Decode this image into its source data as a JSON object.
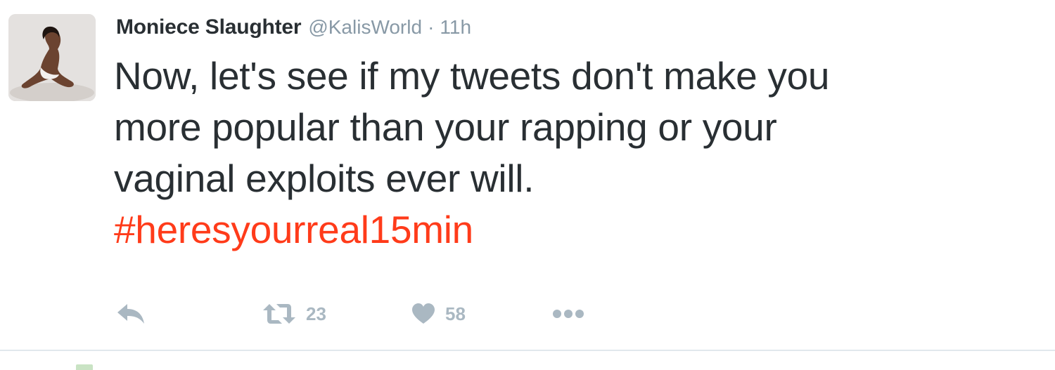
{
  "tweet": {
    "author": {
      "display_name": "Moniece Slaughter",
      "handle": "@KalisWorld",
      "separator": "·",
      "time": "11h",
      "avatar": "profile-photo"
    },
    "text_lines": [
      "Now, let's see if my tweets don't make you",
      "more popular than your rapping or your",
      "vaginal exploits ever will."
    ],
    "hashtag": "#heresyourreal15min",
    "actions": {
      "reply_icon": "reply-icon",
      "retweet_icon": "retweet-icon",
      "retweet_count": "23",
      "like_icon": "heart-icon",
      "like_count": "58",
      "more_icon": "more-dots-icon"
    }
  },
  "colors": {
    "text": "#292f33",
    "secondary": "#8899a6",
    "hashtag": "#ff3b1a",
    "action_gray": "#aab8c2",
    "divider": "#e1e8ed"
  }
}
